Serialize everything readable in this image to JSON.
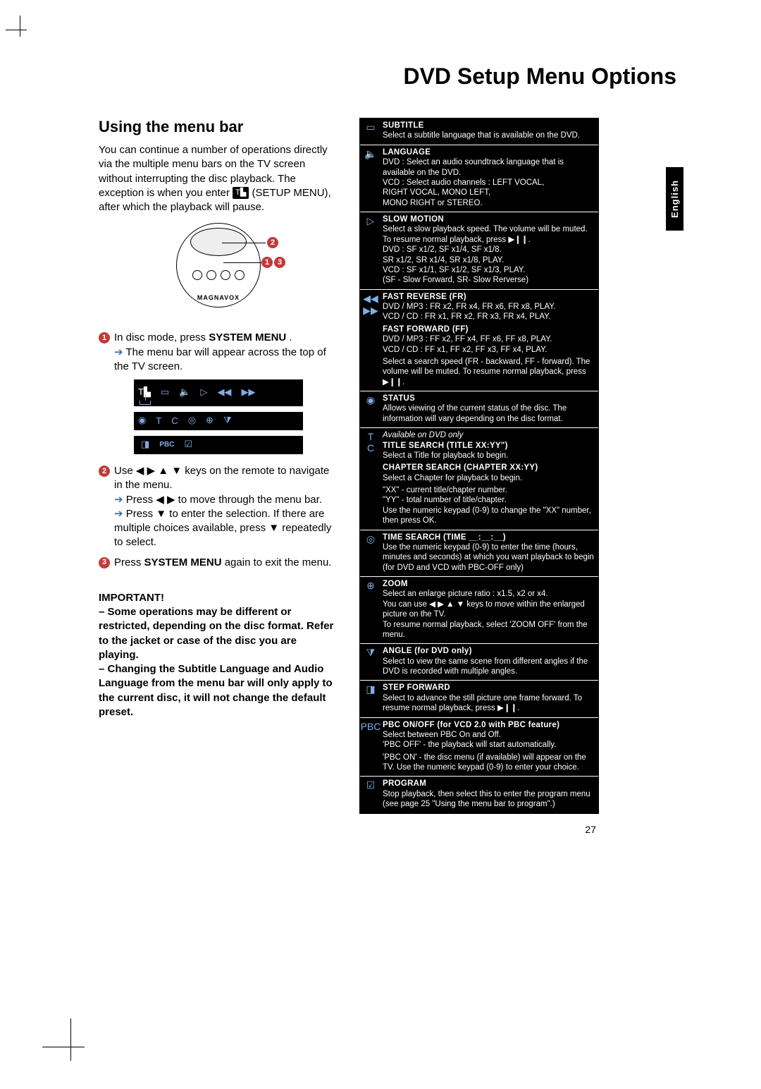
{
  "page_title": "DVD Setup Menu Options",
  "lang_tab": "English",
  "page_number": "27",
  "left": {
    "heading": "Using the menu bar",
    "intro_a": "You can continue a number of operations directly via the multiple menu bars on the TV screen without interrupting the disc playback.  The exception is when you enter ",
    "intro_b": " (SETUP MENU), after which the playback will pause.",
    "setup_icon": "T▙",
    "remote_brand": "MAGNAVOX",
    "step1_a": "In disc mode, press ",
    "step1_b": "SYSTEM MENU",
    "step1_c": ".",
    "step1_sub": "The menu bar will appear across the top of the TV screen.",
    "step2_a": "Use ◀ ▶ ▲ ▼ keys on the remote to navigate in the menu.",
    "step2_sub1": "Press ◀ ▶ to move through the menu bar.",
    "step2_sub2": "Press ▼ to enter the selection.  If there are multiple choices available, press ▼ repeatedly to select.",
    "step3_a": "Press ",
    "step3_b": "SYSTEM MENU",
    "step3_c": " again to exit the menu.",
    "important_title": "IMPORTANT!",
    "important_1": "– Some operations may be different or restricted, depending on the disc format. Refer to the jacket or case of the disc you are playing.",
    "important_2": "– Changing the Subtitle Language and Audio Language from the menu bar will only apply to the current disc, it will not change the default preset.",
    "strip_icons_1": [
      "T▙",
      "▭",
      "🔈",
      "▷",
      "◀◀",
      "▶▶"
    ],
    "strip_icons_2": [
      "◉",
      "T",
      "C",
      "◎",
      "⊕",
      "⧩"
    ],
    "strip_icons_3": [
      "◨",
      "PBC",
      "☑"
    ]
  },
  "rows": [
    {
      "icons": [
        "▭"
      ],
      "title": "SUBTITLE",
      "body": [
        "Select a subtitle language that is available on the DVD."
      ]
    },
    {
      "icons": [
        "🔈"
      ],
      "title": "LANGUAGE",
      "body": [
        "DVD : Select an audio soundtrack language that is",
        "           available on the DVD.",
        "VCD : Select audio channels : LEFT VOCAL,",
        "           RIGHT VOCAL, MONO LEFT,",
        "           MONO RIGHT or STEREO."
      ]
    },
    {
      "icons": [
        "▷"
      ],
      "title": "SLOW MOTION",
      "body": [
        "Select a slow playback speed. The volume will be muted.  To resume normal playback, press  ▶❙❙.",
        "DVD :  SF x1/2, SF x1/4, SF x1/8.",
        "           SR x1/2, SR x1/4, SR x1/8, PLAY.",
        "VCD :  SF x1/1, SF x1/2, SF x1/3, PLAY.",
        "           (SF - Slow Forward, SR- Slow Rerverse)"
      ]
    },
    {
      "icons": [
        "◀◀",
        "▶▶"
      ],
      "title": "FAST REVERSE (FR)",
      "body": [
        "DVD / MP3 : FR x2, FR x4, FR x6, FR x8, PLAY.",
        "VCD / CD : FR x1, FR x2, FR x3, FR x4, PLAY."
      ],
      "title2": "FAST FORWARD (FF)",
      "body2": [
        "DVD / MP3 : FF x2, FF x4, FF x6, FF x8, PLAY.",
        "VCD / CD : FF x1, FF x2, FF x3, FF x4, PLAY."
      ],
      "tail": "Select a search speed (FR - backward, FF - forward). The volume will be muted.  To resume normal playback, press  ▶❙❙."
    },
    {
      "icons": [
        "◉"
      ],
      "title": "STATUS",
      "body": [
        "Allows viewing of the current status of the disc. The information will vary depending on the disc format."
      ]
    },
    {
      "icons": [
        "T",
        "C"
      ],
      "note": "Available on DVD only",
      "title": "TITLE SEARCH (TITLE XX:YY\")",
      "body": [
        "Select a Title for playback to begin."
      ],
      "title2": "CHAPTER SEARCH (CHAPTER XX:YY)",
      "body2": [
        "Select a Chapter for playback to begin."
      ],
      "tail": "\"XX\" - current title/chapter number.\n\"YY\" - total number of title/chapter.\nUse the numeric keypad (0-9) to change the \"XX\" number, then press OK."
    },
    {
      "icons": [
        "◎"
      ],
      "title": "TIME SEARCH (TIME __:__:__)",
      "body": [
        "Use the numeric keypad (0-9) to enter the time (hours, minutes and seconds) at which you want playback to begin (for DVD and VCD with PBC-OFF only)"
      ]
    },
    {
      "icons": [
        "⊕"
      ],
      "title": "ZOOM",
      "body": [
        "Select an enlarge picture ratio : x1.5, x2 or x4.",
        "You can use ◀ ▶ ▲ ▼ keys to move within the enlarged picture on the TV.",
        "To resume normal playback, select 'ZOOM OFF' from the menu."
      ]
    },
    {
      "icons": [
        "⧩"
      ],
      "title": "ANGLE (for DVD only)",
      "body": [
        "Select to view the same scene from different angles if the DVD is recorded with multiple angles."
      ]
    },
    {
      "icons": [
        "◨"
      ],
      "title": "STEP FORWARD",
      "body": [
        "Select to advance the still picture one frame forward. To resume normal playback, press  ▶❙❙."
      ]
    },
    {
      "icons": [
        "PBC"
      ],
      "title": "PBC ON/OFF (for VCD 2.0 with PBC feature)",
      "body": [
        "Select between PBC On and Off.",
        "'PBC OFF' - the playback will start automatically."
      ],
      "tail": "'PBC ON' - the disc menu (if available) will appear on the TV.  Use the numeric keypad (0-9) to enter your choice."
    },
    {
      "icons": [
        "☑"
      ],
      "title": "PROGRAM",
      "body": [
        "Stop playback, then select this to enter the program menu (see page 25 \"Using the menu bar to program\".)"
      ]
    }
  ]
}
